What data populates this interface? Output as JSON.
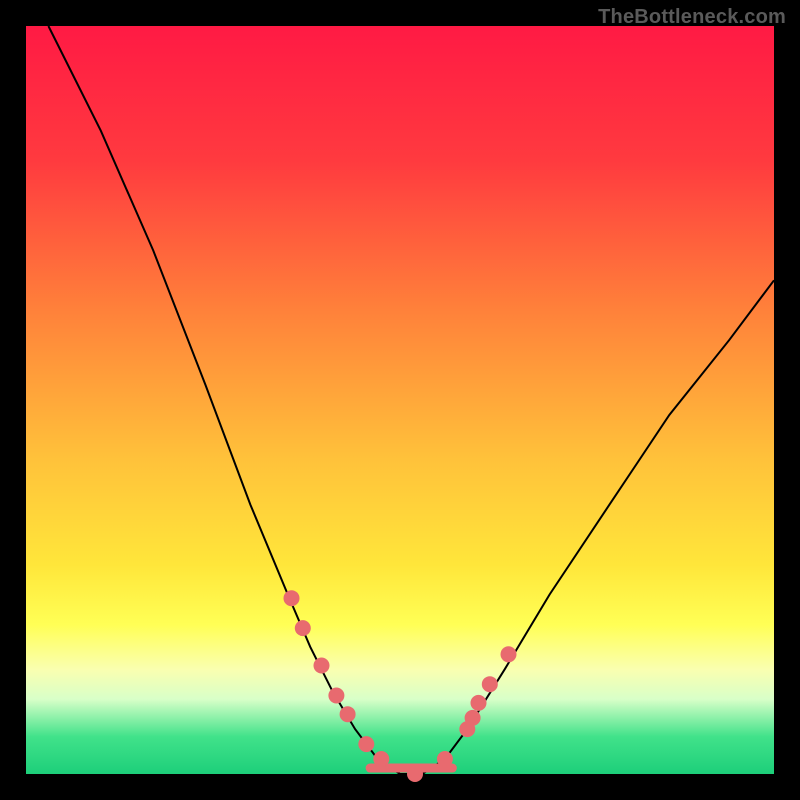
{
  "attribution": "TheBottleneck.com",
  "chart_data": {
    "type": "line",
    "title": "",
    "xlabel": "",
    "ylabel": "",
    "xlim": [
      0,
      100
    ],
    "ylim": [
      0,
      100
    ],
    "series": [
      {
        "name": "bottleneck-curve",
        "x": [
          3,
          10,
          17,
          24,
          30,
          35,
          38,
          41,
          44,
          47,
          50,
          53,
          56,
          59,
          64,
          70,
          78,
          86,
          94,
          100
        ],
        "y": [
          100,
          86,
          70,
          52,
          36,
          24,
          17,
          11,
          6,
          2,
          0,
          0,
          2,
          6,
          14,
          24,
          36,
          48,
          58,
          66
        ]
      }
    ],
    "markers": {
      "name": "highlighted-points",
      "x": [
        35.5,
        37,
        39.5,
        41.5,
        43,
        45.5,
        47.5,
        52,
        56,
        59,
        59.7,
        60.5,
        62,
        64.5
      ],
      "y": [
        23.5,
        19.5,
        14.5,
        10.5,
        8,
        4,
        2,
        0,
        2,
        6,
        7.5,
        9.5,
        12,
        16
      ]
    },
    "gradient_stops": [
      {
        "pct": 0,
        "color": "#ff1a44"
      },
      {
        "pct": 18,
        "color": "#ff3a3f"
      },
      {
        "pct": 38,
        "color": "#ff813a"
      },
      {
        "pct": 58,
        "color": "#ffc23a"
      },
      {
        "pct": 72,
        "color": "#ffe63a"
      },
      {
        "pct": 80,
        "color": "#ffff55"
      },
      {
        "pct": 86,
        "color": "#faffb0"
      },
      {
        "pct": 90,
        "color": "#d8ffc8"
      },
      {
        "pct": 95,
        "color": "#41e28a"
      },
      {
        "pct": 100,
        "color": "#1dcf7a"
      }
    ],
    "plateau": {
      "x0": 46,
      "x1": 57,
      "y": 0.8
    },
    "frame_border_px": 26,
    "marker_color": "#e86a6f",
    "curve_color": "#000000"
  }
}
